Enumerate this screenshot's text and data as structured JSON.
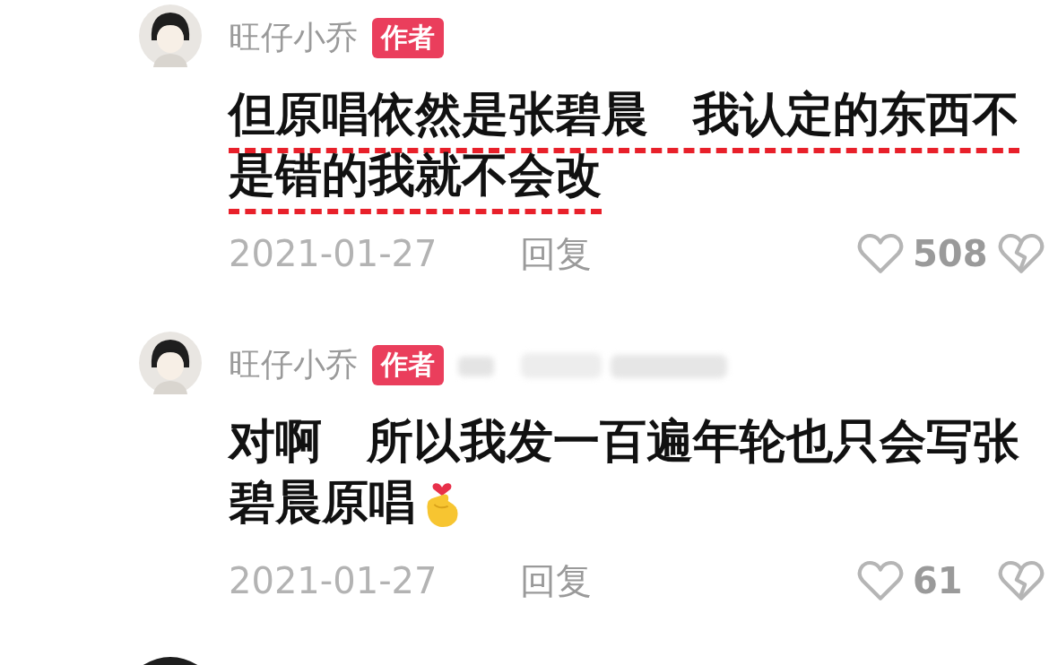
{
  "comments": [
    {
      "author": "旺仔小乔",
      "badge": "作者",
      "redacted": false,
      "highlighted": true,
      "text": "但原唱依然是张碧晨 我认定的东西不是错的我就不会改",
      "emoji": false,
      "date": "2021-01-27",
      "reply": "回复",
      "likes": "508"
    },
    {
      "author": "旺仔小乔",
      "badge": "作者",
      "redacted": true,
      "highlighted": false,
      "text": "对啊 所以我发一百遍年轮也只会写张碧晨原唱",
      "emoji": true,
      "date": "2021-01-27",
      "reply": "回复",
      "likes": "61"
    }
  ]
}
